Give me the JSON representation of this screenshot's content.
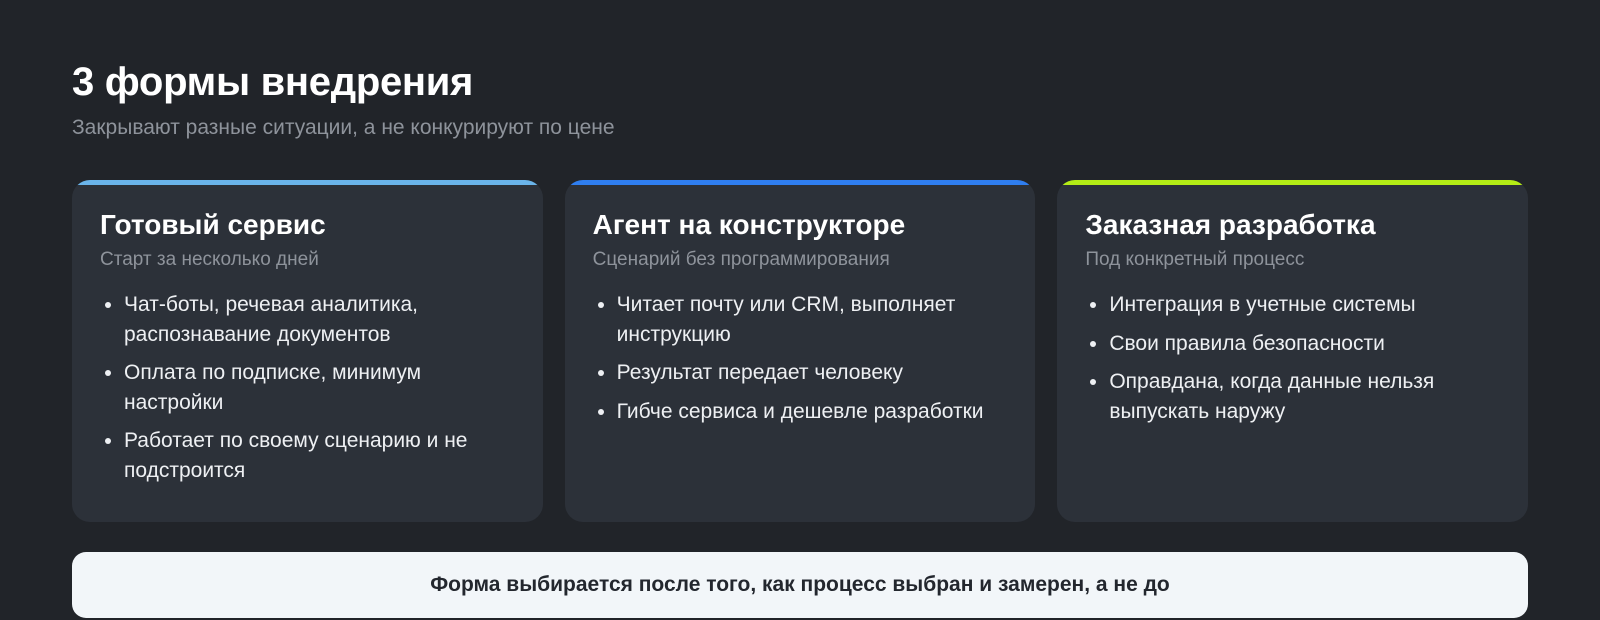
{
  "header": {
    "title": "3 формы внедрения",
    "subtitle": "Закрывают разные ситуации, а не конкурируют по цене"
  },
  "cards": [
    {
      "title": "Готовый сервис",
      "subtitle": "Старт за несколько дней",
      "accent": "#6ab4ea",
      "items": [
        "Чат-боты, речевая аналитика, распознавание документов",
        "Оплата по подписке, минимум настройки",
        "Работает по своему сценарию и не подстроится"
      ]
    },
    {
      "title": "Агент на конструкторе",
      "subtitle": "Сценарий без программирования",
      "accent": "#2f7ef0",
      "items": [
        "Читает почту или CRM, выполняет инструкцию",
        "Результат передает человеку",
        "Гибче сервиса и дешевле разработки"
      ]
    },
    {
      "title": "Заказная разработка",
      "subtitle": "Под конкретный процесс",
      "accent": "#b4ec16",
      "items": [
        "Интеграция в учетные системы",
        "Свои правила безопасности",
        "Оправдана, когда данные нельзя выпускать наружу"
      ]
    }
  ],
  "note": {
    "text": "Форма выбирается после того, как процесс выбран и замерен, а не до"
  },
  "colors": {
    "background": "#212429",
    "card": "#2c3139",
    "note_background": "#f2f6f9"
  }
}
